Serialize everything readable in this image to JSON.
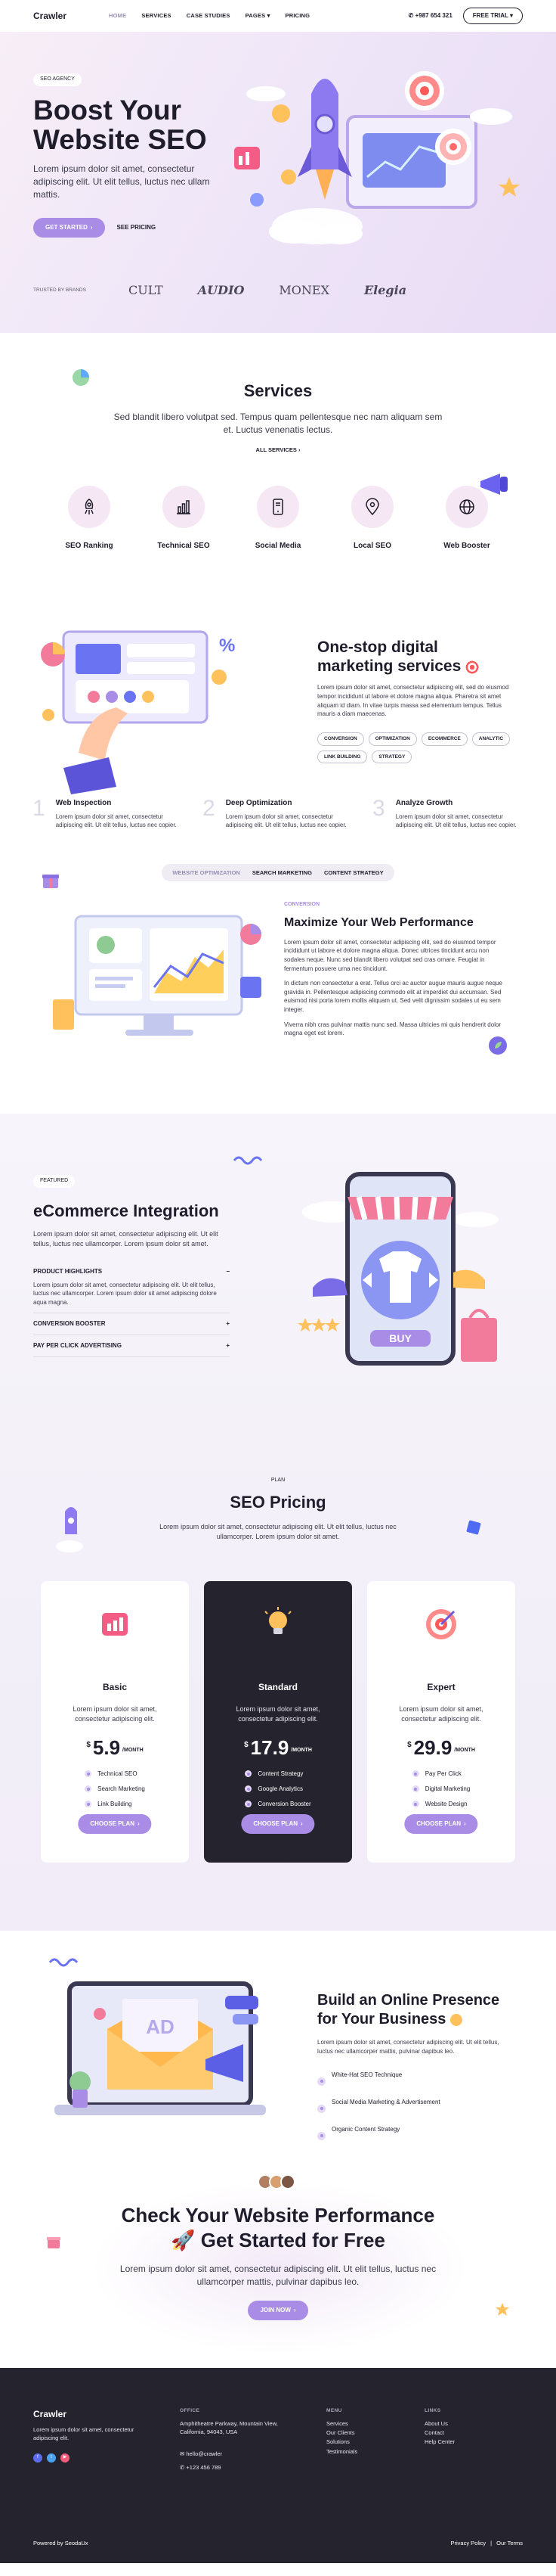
{
  "nav": {
    "logo": "Crawler",
    "links": [
      "HOME",
      "SERVICES",
      "CASE STUDIES",
      "PAGES",
      "PRICING"
    ],
    "phone": "+987 654 321",
    "trial_label": "FREE TRIAL"
  },
  "hero": {
    "eyebrow": "SEO AGENCY",
    "title_line1": "Boost Your",
    "title_line2": "Website SEO",
    "subtitle": "Lorem ipsum dolor sit amet, consectetur adipiscing elit. Ut elit tellus, luctus nec ullam mattis.",
    "cta_primary": "GET STARTED",
    "cta_secondary": "SEE PRICING",
    "brands_label": "TRUSTED BY BRANDS",
    "brands": [
      "CULT",
      "AUDIO",
      "MONEX",
      "Elegia"
    ]
  },
  "services": {
    "title": "Services",
    "subtitle": "Sed blandit libero volutpat sed. Tempus quam pellentesque nec nam aliquam sem et. Luctus venenatis lectus.",
    "all_label": "ALL SERVICES",
    "items": [
      {
        "label": "SEO Ranking",
        "icon": "rocket-icon"
      },
      {
        "label": "Technical SEO",
        "icon": "chart-icon"
      },
      {
        "label": "Social Media",
        "icon": "phone-icon"
      },
      {
        "label": "Local SEO",
        "icon": "pin-icon"
      },
      {
        "label": "Web Booster",
        "icon": "globe-icon"
      }
    ]
  },
  "one_stop": {
    "title_line1": "One-stop digital",
    "title_line2": "marketing services",
    "text": "Lorem ipsum dolor sit amet, consectetur adipiscing elit, sed do eiusmod tempor incididunt ut labore et dolore magna aliqua. Pharetra sit amet aliquam id diam. In vitae turpis massa sed elementum tempus. Tellus mauris a diam maecenas.",
    "tags": [
      "CONVERSION",
      "OPTIMIZATION",
      "ECOMMERCE",
      "ANALYTIC",
      "LINK BUILDING",
      "STRATEGY"
    ]
  },
  "steps": [
    {
      "num": "1",
      "title": "Web Inspection",
      "text": "Lorem ipsum dolor sit amet, consectetur adipiscing elit. Ut elit tellus, luctus nec copier."
    },
    {
      "num": "2",
      "title": "Deep Optimization",
      "text": "Lorem ipsum dolor sit amet, consectetur adipiscing elit. Ut elit tellus, luctus nec copier."
    },
    {
      "num": "3",
      "title": "Analyze Growth",
      "text": "Lorem ipsum dolor sit amet, consectetur adipiscing elit. Ut elit tellus, luctus nec copier."
    }
  ],
  "tabs": [
    "WEBSITE OPTIMIZATION",
    "SEARCH MARKETING",
    "CONTENT STRATEGY"
  ],
  "maximize": {
    "eyebrow": "CONVERSION",
    "title": "Maximize Your Web Performance",
    "p1": "Lorem ipsum dolor sit amet, consectetur adipiscing elit, sed do eiusmod tempor incididunt ut labore et dolore magna aliqua. Donec ultrices tincidunt arcu non sodales neque. Nunc sed blandit libero volutpat sed cras ornare. Feugiat in fermentum posuere urna nec tincidunt.",
    "p2": "In dictum non consectetur a erat. Tellus orci ac auctor augue mauris augue neque gravida in. Pellentesque adipiscing commodo elit at imperdiet dui accumsan. Sed euismod nisi porta lorem mollis aliquam ut. Sed velit dignissim sodales ut eu sem integer.",
    "p3": "Viverra nibh cras pulvinar mattis nunc sed. Massa ultricies mi quis hendrerit dolor magna eget est lorem."
  },
  "ecommerce": {
    "eyebrow": "FEATURED",
    "title": "eCommerce Integration",
    "intro": "Lorem ipsum dolor sit amet, consectetur adipiscing elit. Ut elit tellus, luctus nec ullamcorper. Lorem ipsum dolor sit amet.",
    "accordion": [
      {
        "title": "PRODUCT HIGHLIGHTS",
        "icon": "−",
        "body": "Lorem ipsum dolor sit amet, consectetur adipiscing elit. Ut elit tellus, luctus nec ullamcorper. Lorem ipsum dolor sit amet adipiscing dolore aqua magna."
      },
      {
        "title": "CONVERSION BOOSTER",
        "icon": "+"
      },
      {
        "title": "PAY PER CLICK ADVERTISING",
        "icon": "+"
      }
    ]
  },
  "pricing": {
    "eyebrow": "PLAN",
    "title": "SEO Pricing",
    "subtitle": "Lorem ipsum dolor sit amet, consectetur adipiscing elit. Ut elit tellus, luctus nec ullamcorper. Lorem ipsum dolor sit amet.",
    "plans": [
      {
        "name": "Basic",
        "desc": "Lorem ipsum dolor sit amet, consectetur adipiscing elit.",
        "currency": "$",
        "price": "5.9",
        "period": "/MONTH",
        "features": [
          "Technical SEO",
          "Search Marketing",
          "Link Building"
        ],
        "cta": "CHOOSE PLAN"
      },
      {
        "name": "Standard",
        "desc": "Lorem ipsum dolor sit amet, consectetur adipiscing elit.",
        "currency": "$",
        "price": "17.9",
        "period": "/MONTH",
        "features": [
          "Content Strategy",
          "Google Analytics",
          "Conversion Booster"
        ],
        "cta": "CHOOSE PLAN"
      },
      {
        "name": "Expert",
        "desc": "Lorem ipsum dolor sit amet, consectetur adipiscing elit.",
        "currency": "$",
        "price": "29.9",
        "period": "/MONTH",
        "features": [
          "Pay Per Click",
          "Digital Marketing",
          "Website Design"
        ],
        "cta": "CHOOSE PLAN"
      }
    ]
  },
  "build": {
    "title_line1": "Build an Online Presence",
    "title_line2": "for Your Business",
    "text": "Lorem ipsum dolor sit amet, consectetur adipiscing elit. Ut elit tellus, luctus nec ullamcorper mattis, pulvinar dapibus leo.",
    "checks": [
      "White-Hat SEO Technique",
      "Social Media Marketing & Advertisement",
      "Organic Content Strategy"
    ]
  },
  "cta": {
    "title_line1": "Check Your Website Performance",
    "title_line2": "Get Started for Free",
    "text": "Lorem ipsum dolor sit amet, consectetur adipiscing elit. Ut elit tellus, luctus nec ullamcorper mattis, pulvinar dapibus leo.",
    "button": "JOIN NOW"
  },
  "footer": {
    "logo": "Crawler",
    "about": "Lorem ipsum dolor sit amet, consectetur adipiscing elit.",
    "office_head": "OFFICE",
    "address": "Amphitheatre Parkway, Mountain View, California, 94043, USA",
    "email": "hello@crawler",
    "phone": "+123 456 789",
    "menu_head": "MENU",
    "menu": [
      "Services",
      "Our Clients",
      "Solutions",
      "Testimonials"
    ],
    "links_head": "LINKS",
    "links": [
      "About Us",
      "Contact",
      "Help Center"
    ],
    "powered": "Powered by SeodaUx",
    "privacy": "Privacy Policy",
    "separator": "|",
    "terms": "Our Terms"
  }
}
